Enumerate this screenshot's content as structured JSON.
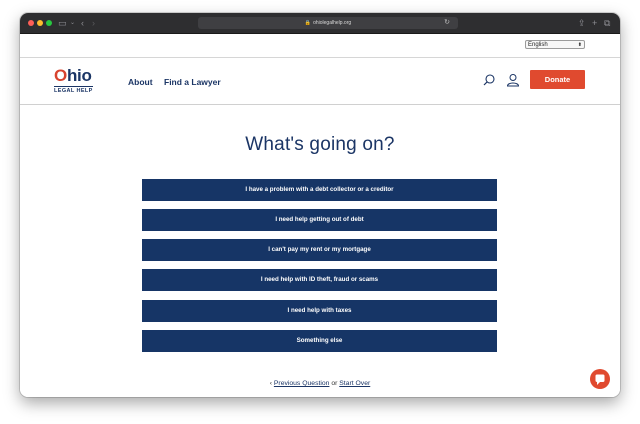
{
  "browser": {
    "url": "ohiolegalhelp.org"
  },
  "language": {
    "selected": "English"
  },
  "header": {
    "logo_word_o": "O",
    "logo_word_rest": "hio",
    "logo_sub": "LEGAL HELP",
    "nav": [
      "About",
      "Find a Lawyer"
    ],
    "donate_label": "Donate"
  },
  "main": {
    "question": "What's going on?",
    "options": [
      "I have a problem with a debt collector or a creditor",
      "I need help getting out of debt",
      "I can't pay my rent or my mortgage",
      "I need help with ID theft, fraud or scams",
      "I need help with taxes",
      "Something else"
    ],
    "footer": {
      "prefix": "‹ ",
      "previous_label": "Previous Question",
      "or_text": " or ",
      "start_over_label": "Start Over"
    }
  },
  "colors": {
    "brand_navy": "#163566",
    "accent_red": "#e04a2f"
  }
}
